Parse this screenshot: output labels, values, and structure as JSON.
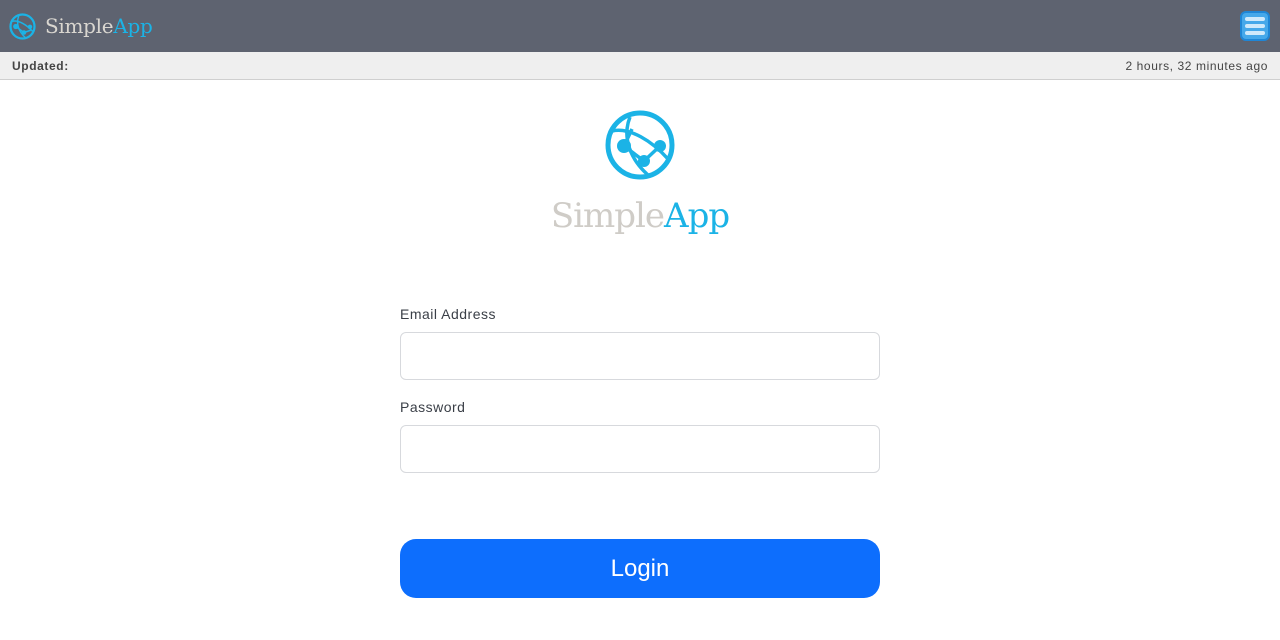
{
  "navbar": {
    "brand_simple": "Simple",
    "brand_app": "App",
    "logo_icon": "globe-network-icon",
    "menu_icon": "hamburger-menu-icon"
  },
  "status": {
    "label": "Updated:",
    "value": "2 hours, 32 minutes ago"
  },
  "hero": {
    "simple": "Simple",
    "app": "App",
    "logo_icon": "globe-network-icon"
  },
  "form": {
    "email_label": "Email Address",
    "email_value": "",
    "password_label": "Password",
    "password_value": "",
    "login_label": "Login"
  },
  "colors": {
    "navbar_bg": "#5e6370",
    "accent": "#1bb3e6",
    "login_button": "#0d6efd",
    "menu_button": "#45a8ea"
  }
}
